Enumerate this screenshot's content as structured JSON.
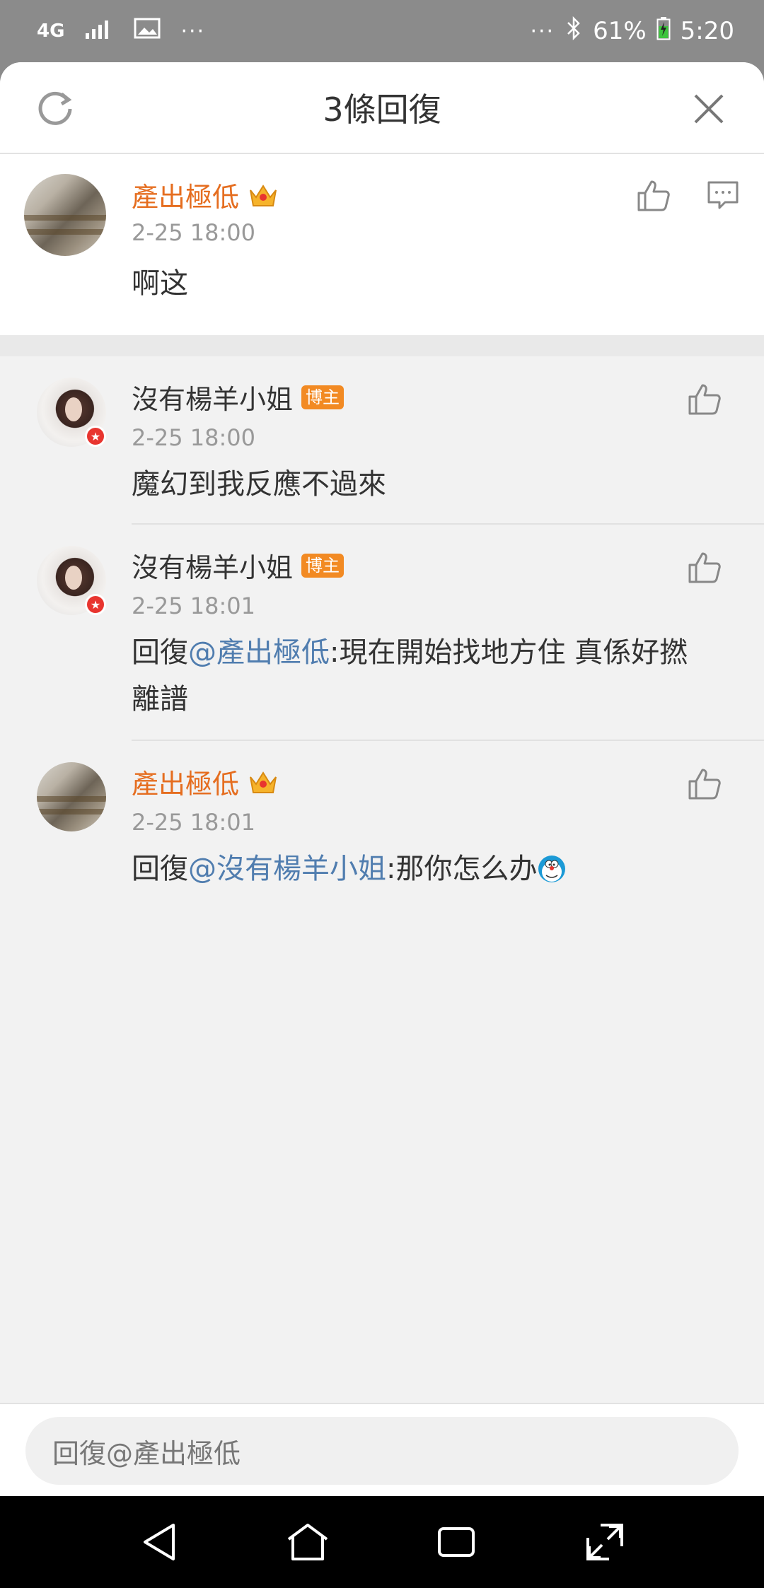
{
  "status_bar": {
    "network": "4G",
    "left_dots": "···",
    "right_dots": "···",
    "battery": "61%",
    "time": "5:20"
  },
  "header": {
    "title": "3條回復"
  },
  "main_comment": {
    "username": "產出極低",
    "timestamp": "2-25 18:00",
    "text": "啊这"
  },
  "replies": [
    {
      "username": "沒有楊羊小姐",
      "badge": "博主",
      "timestamp": "2-25 18:00",
      "text": "魔幻到我反應不過來"
    },
    {
      "username": "沒有楊羊小姐",
      "badge": "博主",
      "timestamp": "2-25 18:01",
      "prefix": "回復",
      "mention": "@產出極低",
      "text": ":現在開始找地方住 真係好撚",
      "text2": "離譜"
    },
    {
      "username": "產出極低",
      "timestamp": "2-25 18:01",
      "prefix": "回復",
      "mention": "@沒有楊羊小姐",
      "text": ":那你怎么办"
    }
  ],
  "footer": {
    "placeholder": "回復@產出極低"
  },
  "colors": {
    "username_orange": "#e56d1f",
    "mention_blue": "#507daf",
    "badge_orange": "#f28a23"
  }
}
